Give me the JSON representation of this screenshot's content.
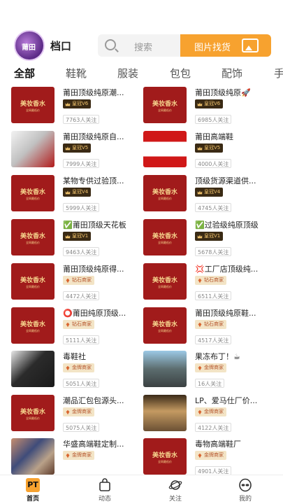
{
  "header": {
    "logo_text": "莆田",
    "brand": "档口",
    "search_placeholder": "搜索",
    "image_search_label": "图片找货"
  },
  "tabs": [
    "全部",
    "鞋靴",
    "服装",
    "包包",
    "配饰",
    "手"
  ],
  "thumb_texts": {
    "main": "美妆香水",
    "sub": "全网最低价"
  },
  "shops": [
    {
      "name": "莆田顶级纯原潮...",
      "badge": "皇冠V6",
      "badge_type": "vip",
      "follow": "7763人关注",
      "thumb": "logo"
    },
    {
      "name": "莆田顶级纯原🚀",
      "badge": "皇冠V6",
      "badge_type": "vip",
      "follow": "6985人关注",
      "thumb": "logo"
    },
    {
      "name": "莆田顶级纯原自...",
      "badge": "皇冠V5",
      "badge_type": "vip",
      "follow": "7999人关注",
      "thumb": "sneaker"
    },
    {
      "name": "莆田高端鞋",
      "badge": "皇冠V5",
      "badge_type": "vip",
      "follow": "4000人关注",
      "thumb": "ad"
    },
    {
      "name": "某物专供过验顶...",
      "badge": "皇冠V4",
      "badge_type": "vip",
      "follow": "5999人关注",
      "thumb": "logo"
    },
    {
      "name": "顶级货源渠道供...",
      "badge": "皇冠V4",
      "badge_type": "vip",
      "follow": "4745人关注",
      "thumb": "logo"
    },
    {
      "name": "✅莆田顶级天花板",
      "badge": "皇冠V1",
      "badge_type": "vip",
      "follow": "9463人关注",
      "thumb": "logo"
    },
    {
      "name": "✅过验级纯原顶级",
      "badge": "皇冠V1",
      "badge_type": "vip",
      "follow": "5678人关注",
      "thumb": "logo"
    },
    {
      "name": "莆田顶级纯原得...",
      "badge": "钻石商家",
      "badge_type": "diamond",
      "follow": "4472人关注",
      "thumb": "logo"
    },
    {
      "name": "💢工厂店顶级纯...",
      "badge": "钻石商家",
      "badge_type": "diamond",
      "follow": "6511人关注",
      "thumb": "logo"
    },
    {
      "name": "⭕莆田纯原顶级...",
      "badge": "钻石商家",
      "badge_type": "diamond",
      "follow": "5111人关注",
      "thumb": "logo"
    },
    {
      "name": "莆田顶级纯原鞋...",
      "badge": "钻石商家",
      "badge_type": "diamond",
      "follow": "4517人关注",
      "thumb": "logo"
    },
    {
      "name": "毒鞋社",
      "badge": "金牌商家",
      "badge_type": "diamond",
      "follow": "5051人关注",
      "thumb": "dark"
    },
    {
      "name": "果冻布丁！☕",
      "badge": "金牌商家",
      "badge_type": "diamond",
      "follow": "16人关注",
      "thumb": "street"
    },
    {
      "name": "潮品汇包包源头...",
      "badge": "金牌商家",
      "badge_type": "diamond",
      "follow": "5075人关注",
      "thumb": "logo"
    },
    {
      "name": "LP、爱马仕厂价...",
      "badge": "金牌商家",
      "badge_type": "diamond",
      "follow": "4122人关注",
      "thumb": "store"
    },
    {
      "name": "华盛高端鞋定制...",
      "badge": "金牌商家",
      "badge_type": "diamond",
      "follow": "",
      "thumb": "shoes"
    },
    {
      "name": "毒物高端鞋厂",
      "badge": "金牌商家",
      "badge_type": "diamond",
      "follow": "4901人关注",
      "thumb": "logo"
    }
  ],
  "nav": [
    {
      "label": "首页",
      "icon": "home-pt-icon",
      "active": true
    },
    {
      "label": "动态",
      "icon": "bag-icon",
      "active": false
    },
    {
      "label": "关注",
      "icon": "planet-icon",
      "active": false
    },
    {
      "label": "我的",
      "icon": "alien-face-icon",
      "active": false
    }
  ],
  "colors": {
    "accent": "#f7a22f",
    "thumb_red": "#a11b1b",
    "vip_dark": "#3a2a14"
  }
}
